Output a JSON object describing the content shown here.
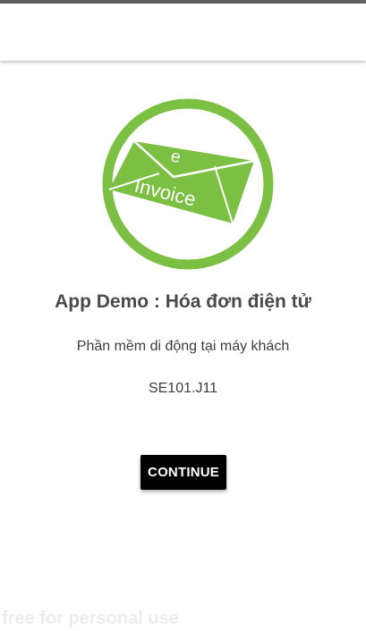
{
  "colors": {
    "status_strip": "#616161",
    "brand_green": "#7bc043",
    "title_text": "#4a4a4a",
    "button_bg": "#000000",
    "button_text": "#ffffff"
  },
  "logo": {
    "icon": "envelope-icon",
    "letter": "e",
    "text": "Invoice"
  },
  "main": {
    "title": "App Demo : Hóa đơn điện tử",
    "subtitle": "Phần mềm di động tại máy khách",
    "code": "SE101.J11",
    "continue_label": "CONTINUE"
  },
  "watermark": "free for personal use"
}
